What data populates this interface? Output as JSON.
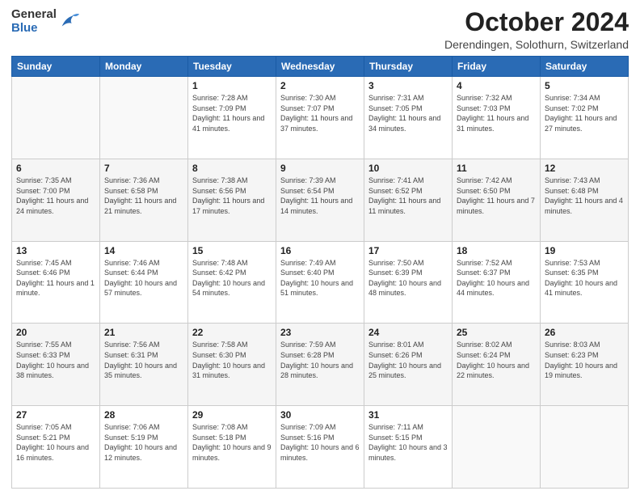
{
  "header": {
    "logo_general": "General",
    "logo_blue": "Blue",
    "month_title": "October 2024",
    "location": "Derendingen, Solothurn, Switzerland"
  },
  "days_of_week": [
    "Sunday",
    "Monday",
    "Tuesday",
    "Wednesday",
    "Thursday",
    "Friday",
    "Saturday"
  ],
  "weeks": [
    [
      {
        "day": "",
        "info": ""
      },
      {
        "day": "",
        "info": ""
      },
      {
        "day": "1",
        "info": "Sunrise: 7:28 AM\nSunset: 7:09 PM\nDaylight: 11 hours and 41 minutes."
      },
      {
        "day": "2",
        "info": "Sunrise: 7:30 AM\nSunset: 7:07 PM\nDaylight: 11 hours and 37 minutes."
      },
      {
        "day": "3",
        "info": "Sunrise: 7:31 AM\nSunset: 7:05 PM\nDaylight: 11 hours and 34 minutes."
      },
      {
        "day": "4",
        "info": "Sunrise: 7:32 AM\nSunset: 7:03 PM\nDaylight: 11 hours and 31 minutes."
      },
      {
        "day": "5",
        "info": "Sunrise: 7:34 AM\nSunset: 7:02 PM\nDaylight: 11 hours and 27 minutes."
      }
    ],
    [
      {
        "day": "6",
        "info": "Sunrise: 7:35 AM\nSunset: 7:00 PM\nDaylight: 11 hours and 24 minutes."
      },
      {
        "day": "7",
        "info": "Sunrise: 7:36 AM\nSunset: 6:58 PM\nDaylight: 11 hours and 21 minutes."
      },
      {
        "day": "8",
        "info": "Sunrise: 7:38 AM\nSunset: 6:56 PM\nDaylight: 11 hours and 17 minutes."
      },
      {
        "day": "9",
        "info": "Sunrise: 7:39 AM\nSunset: 6:54 PM\nDaylight: 11 hours and 14 minutes."
      },
      {
        "day": "10",
        "info": "Sunrise: 7:41 AM\nSunset: 6:52 PM\nDaylight: 11 hours and 11 minutes."
      },
      {
        "day": "11",
        "info": "Sunrise: 7:42 AM\nSunset: 6:50 PM\nDaylight: 11 hours and 7 minutes."
      },
      {
        "day": "12",
        "info": "Sunrise: 7:43 AM\nSunset: 6:48 PM\nDaylight: 11 hours and 4 minutes."
      }
    ],
    [
      {
        "day": "13",
        "info": "Sunrise: 7:45 AM\nSunset: 6:46 PM\nDaylight: 11 hours and 1 minute."
      },
      {
        "day": "14",
        "info": "Sunrise: 7:46 AM\nSunset: 6:44 PM\nDaylight: 10 hours and 57 minutes."
      },
      {
        "day": "15",
        "info": "Sunrise: 7:48 AM\nSunset: 6:42 PM\nDaylight: 10 hours and 54 minutes."
      },
      {
        "day": "16",
        "info": "Sunrise: 7:49 AM\nSunset: 6:40 PM\nDaylight: 10 hours and 51 minutes."
      },
      {
        "day": "17",
        "info": "Sunrise: 7:50 AM\nSunset: 6:39 PM\nDaylight: 10 hours and 48 minutes."
      },
      {
        "day": "18",
        "info": "Sunrise: 7:52 AM\nSunset: 6:37 PM\nDaylight: 10 hours and 44 minutes."
      },
      {
        "day": "19",
        "info": "Sunrise: 7:53 AM\nSunset: 6:35 PM\nDaylight: 10 hours and 41 minutes."
      }
    ],
    [
      {
        "day": "20",
        "info": "Sunrise: 7:55 AM\nSunset: 6:33 PM\nDaylight: 10 hours and 38 minutes."
      },
      {
        "day": "21",
        "info": "Sunrise: 7:56 AM\nSunset: 6:31 PM\nDaylight: 10 hours and 35 minutes."
      },
      {
        "day": "22",
        "info": "Sunrise: 7:58 AM\nSunset: 6:30 PM\nDaylight: 10 hours and 31 minutes."
      },
      {
        "day": "23",
        "info": "Sunrise: 7:59 AM\nSunset: 6:28 PM\nDaylight: 10 hours and 28 minutes."
      },
      {
        "day": "24",
        "info": "Sunrise: 8:01 AM\nSunset: 6:26 PM\nDaylight: 10 hours and 25 minutes."
      },
      {
        "day": "25",
        "info": "Sunrise: 8:02 AM\nSunset: 6:24 PM\nDaylight: 10 hours and 22 minutes."
      },
      {
        "day": "26",
        "info": "Sunrise: 8:03 AM\nSunset: 6:23 PM\nDaylight: 10 hours and 19 minutes."
      }
    ],
    [
      {
        "day": "27",
        "info": "Sunrise: 7:05 AM\nSunset: 5:21 PM\nDaylight: 10 hours and 16 minutes."
      },
      {
        "day": "28",
        "info": "Sunrise: 7:06 AM\nSunset: 5:19 PM\nDaylight: 10 hours and 12 minutes."
      },
      {
        "day": "29",
        "info": "Sunrise: 7:08 AM\nSunset: 5:18 PM\nDaylight: 10 hours and 9 minutes."
      },
      {
        "day": "30",
        "info": "Sunrise: 7:09 AM\nSunset: 5:16 PM\nDaylight: 10 hours and 6 minutes."
      },
      {
        "day": "31",
        "info": "Sunrise: 7:11 AM\nSunset: 5:15 PM\nDaylight: 10 hours and 3 minutes."
      },
      {
        "day": "",
        "info": ""
      },
      {
        "day": "",
        "info": ""
      }
    ]
  ]
}
